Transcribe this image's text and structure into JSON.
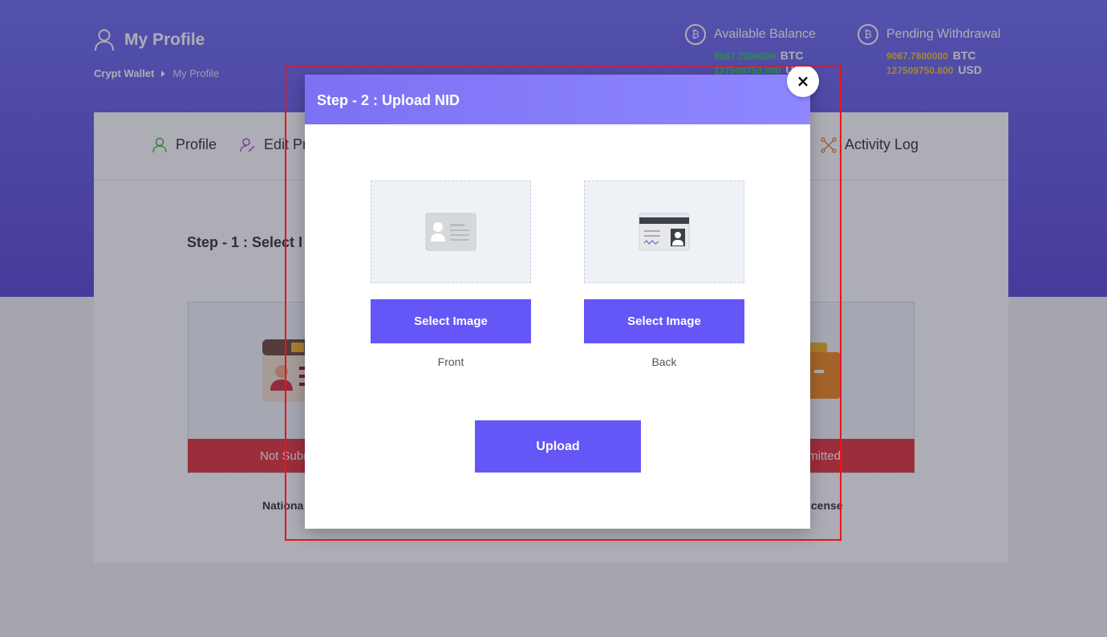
{
  "header": {
    "page_title": "My Profile",
    "breadcrumb": [
      "Crypt Wallet",
      "My Profile"
    ]
  },
  "balances": {
    "available": {
      "label": "Available Balance",
      "btc_value": "9067.7800000",
      "btc_unit": "BTC",
      "usd_value": "127509750.800",
      "usd_unit": "USD"
    },
    "pending": {
      "label": "Pending Withdrawal",
      "btc_value": "9067.7800000",
      "btc_unit": "BTC",
      "usd_value": "127509750.800",
      "usd_unit": "USD"
    }
  },
  "tabs": [
    {
      "label": "Profile",
      "icon": "user-icon"
    },
    {
      "label": "Edit Pr",
      "icon": "edit-user-icon"
    },
    {
      "label": "Activity Log",
      "icon": "network-icon"
    }
  ],
  "step1": {
    "title": "Step - 1 : Select I"
  },
  "documents": {
    "status_left": "Not Subm",
    "status_right": "mitted",
    "label_left": "Nationa",
    "label_right": "icense"
  },
  "modal": {
    "title": "Step - 2 : Upload NID",
    "close_symbol": "×",
    "front": {
      "button": "Select Image",
      "label": "Front"
    },
    "back": {
      "button": "Select Image",
      "label": "Back"
    },
    "upload_button": "Upload"
  },
  "colors": {
    "accent": "#6456f7",
    "status_red": "#e2323a",
    "highlight_red": "#e8141a"
  }
}
